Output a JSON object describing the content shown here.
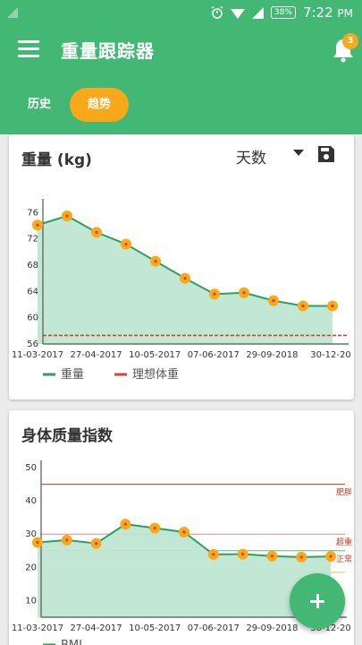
{
  "status_bar": {
    "time": "7:22",
    "period": "PM",
    "battery": "38%"
  },
  "app_bar": {
    "title": "重量跟踪器",
    "notification_count": "3"
  },
  "tabs": [
    {
      "label": "历史",
      "active": false
    },
    {
      "label": "趋势",
      "active": true
    }
  ],
  "colors": {
    "primary": "#43b874",
    "accent": "#f7a81b",
    "line": "#2e9e62",
    "area": "#bfe6d3",
    "ideal": "#d9432c"
  },
  "icons": [
    "menu-icon",
    "bell-icon",
    "dropdown-arrow-icon",
    "save-icon",
    "add-icon"
  ],
  "weight_card": {
    "title": "重量 (kg)",
    "range_label": "天数"
  },
  "bmi_card": {
    "title": "身体质量指数"
  },
  "chart_data": [
    {
      "type": "area",
      "xlabel": "",
      "ylabel": "",
      "ylim": [
        56,
        77
      ],
      "yticks": [
        56,
        60,
        64,
        68,
        72,
        76
      ],
      "x_tick_labels": [
        "11-03-2017",
        "27-04-2017",
        "10-05-2017",
        "07-06-2017",
        "29-09-2018",
        "30-12-20"
      ],
      "values": [
        74.1,
        75.5,
        73.0,
        71.2,
        68.6,
        66.0,
        63.6,
        63.8,
        62.6,
        61.8,
        61.8
      ],
      "series": [
        {
          "name": "重量",
          "values": [
            74.1,
            75.5,
            73.0,
            71.2,
            68.6,
            66.0,
            63.6,
            63.8,
            62.6,
            61.8,
            61.8
          ]
        },
        {
          "name": "理想体重",
          "value": 57.3
        }
      ]
    },
    {
      "type": "area",
      "xlabel": "",
      "ylabel": "",
      "ylim": [
        5,
        50
      ],
      "yticks": [
        10,
        20,
        30,
        40,
        50
      ],
      "x_tick_labels": [
        "11-03-2017",
        "27-04-2017",
        "10-05-2017",
        "07-06-2017",
        "29-09-2018",
        "30-12-20"
      ],
      "values": [
        27.5,
        28.2,
        27.2,
        33.0,
        31.8,
        30.6,
        23.9,
        24.0,
        23.4,
        23.1,
        23.3
      ],
      "series": [
        {
          "name": "BMI",
          "values": [
            27.5,
            28.2,
            27.2,
            33.0,
            31.8,
            30.6,
            23.9,
            24.0,
            23.4,
            23.1,
            23.3
          ]
        }
      ],
      "zones": [
        {
          "label": "肥胖",
          "value": 45
        },
        {
          "label": "超重",
          "value": 30
        },
        {
          "label": "正常",
          "value": 25
        },
        {
          "label": "",
          "value": 18.5
        }
      ]
    }
  ]
}
